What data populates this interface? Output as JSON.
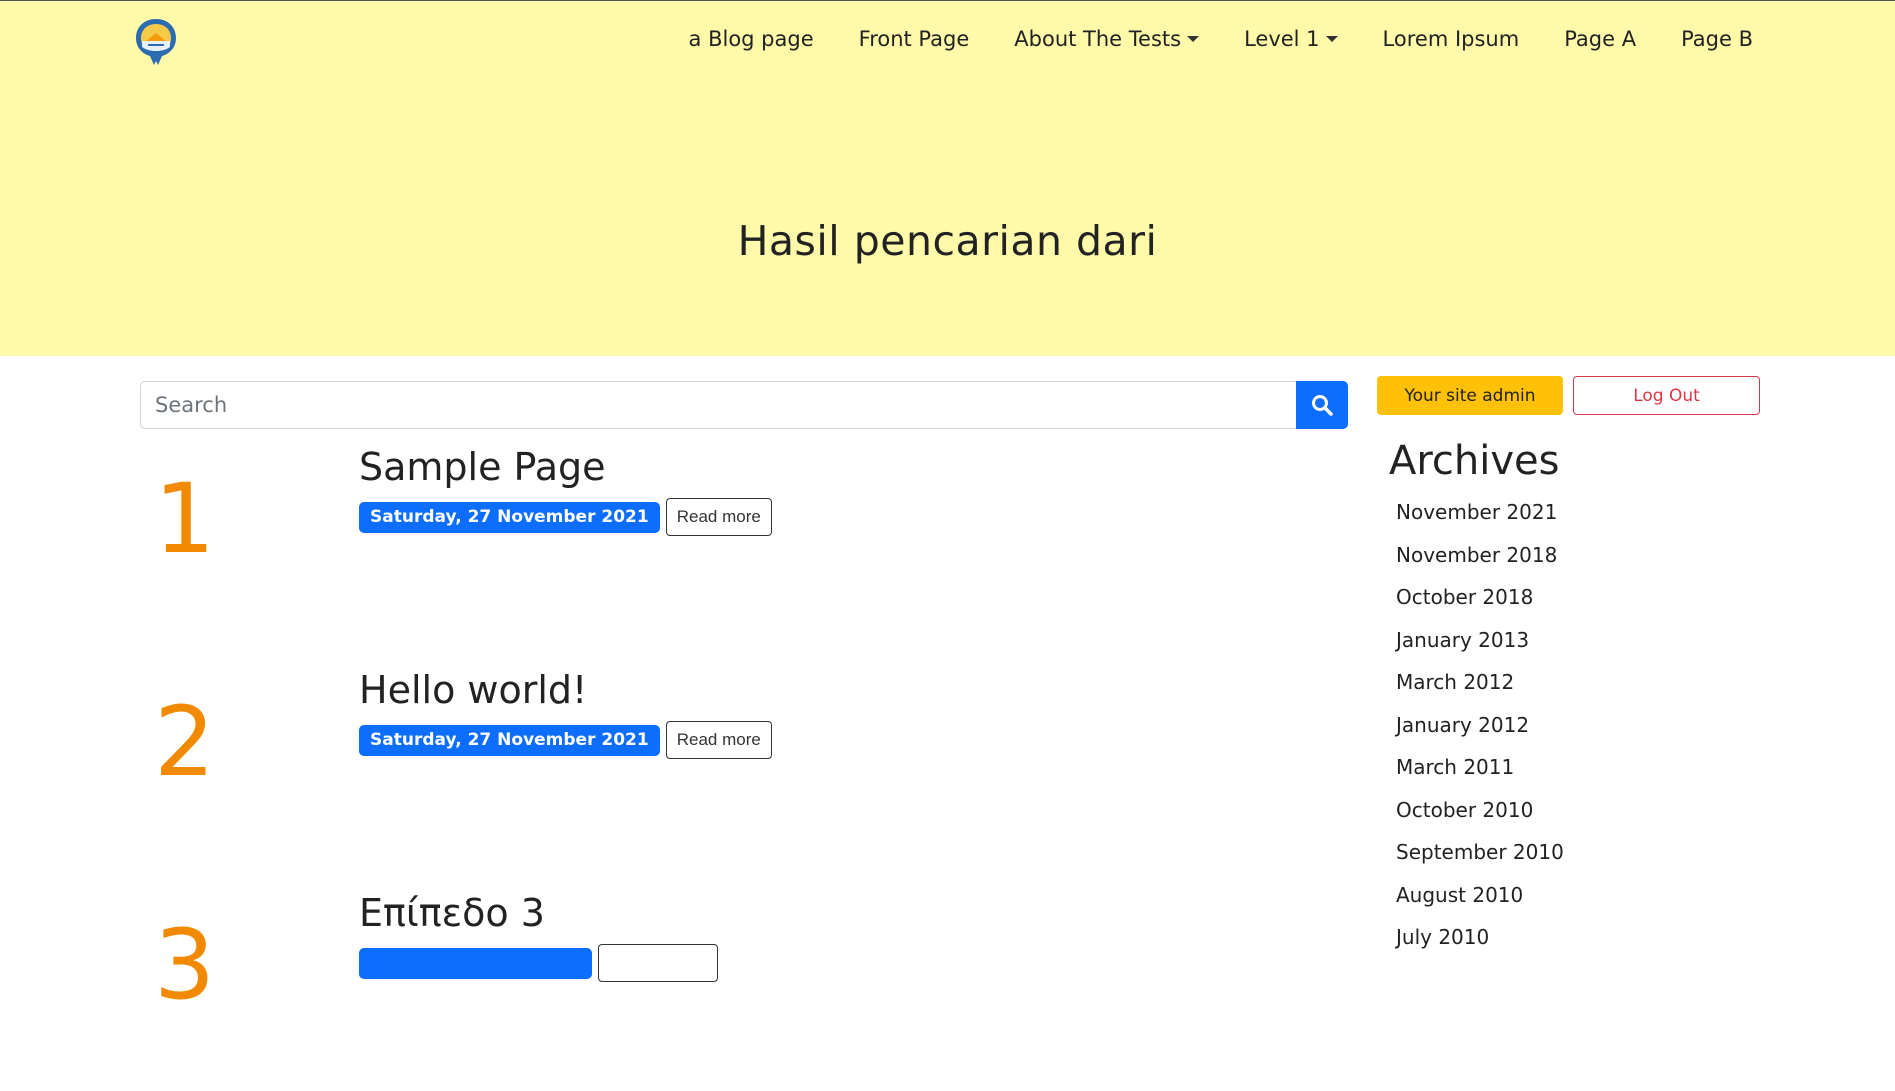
{
  "nav": {
    "items": [
      {
        "label": "a Blog page",
        "has_dropdown": false
      },
      {
        "label": "Front Page",
        "has_dropdown": false
      },
      {
        "label": "About The Tests",
        "has_dropdown": true
      },
      {
        "label": "Level 1",
        "has_dropdown": true
      },
      {
        "label": "Lorem Ipsum",
        "has_dropdown": false
      },
      {
        "label": "Page A",
        "has_dropdown": false
      },
      {
        "label": "Page B",
        "has_dropdown": false
      }
    ]
  },
  "hero": {
    "title": "Hasil pencarian dari",
    "background_color": "#fffaaa"
  },
  "search": {
    "placeholder": "Search",
    "value": "",
    "button_icon": "search-icon",
    "button_color": "#0d6efd"
  },
  "admin": {
    "site_admin_label": "Your site admin",
    "logout_label": "Log Out"
  },
  "posts": [
    {
      "number": "1",
      "title": "Sample Page",
      "date": "Saturday, 27 November 2021",
      "read_more": "Read more"
    },
    {
      "number": "2",
      "title": "Hello world!",
      "date": "Saturday, 27 November 2021",
      "read_more": "Read more"
    },
    {
      "number": "3",
      "title": "Επίπεδο 3",
      "date": "",
      "read_more": ""
    }
  ],
  "archives": {
    "title": "Archives",
    "items": [
      "November 2021",
      "November 2018",
      "October 2018",
      "January 2013",
      "March 2012",
      "January 2012",
      "March 2011",
      "October 2010",
      "September 2010",
      "August 2010",
      "July 2010"
    ]
  },
  "colors": {
    "accent_number": "#f18a00",
    "badge": "#0d6efd",
    "warning": "#ffc107",
    "danger": "#dc3545"
  }
}
